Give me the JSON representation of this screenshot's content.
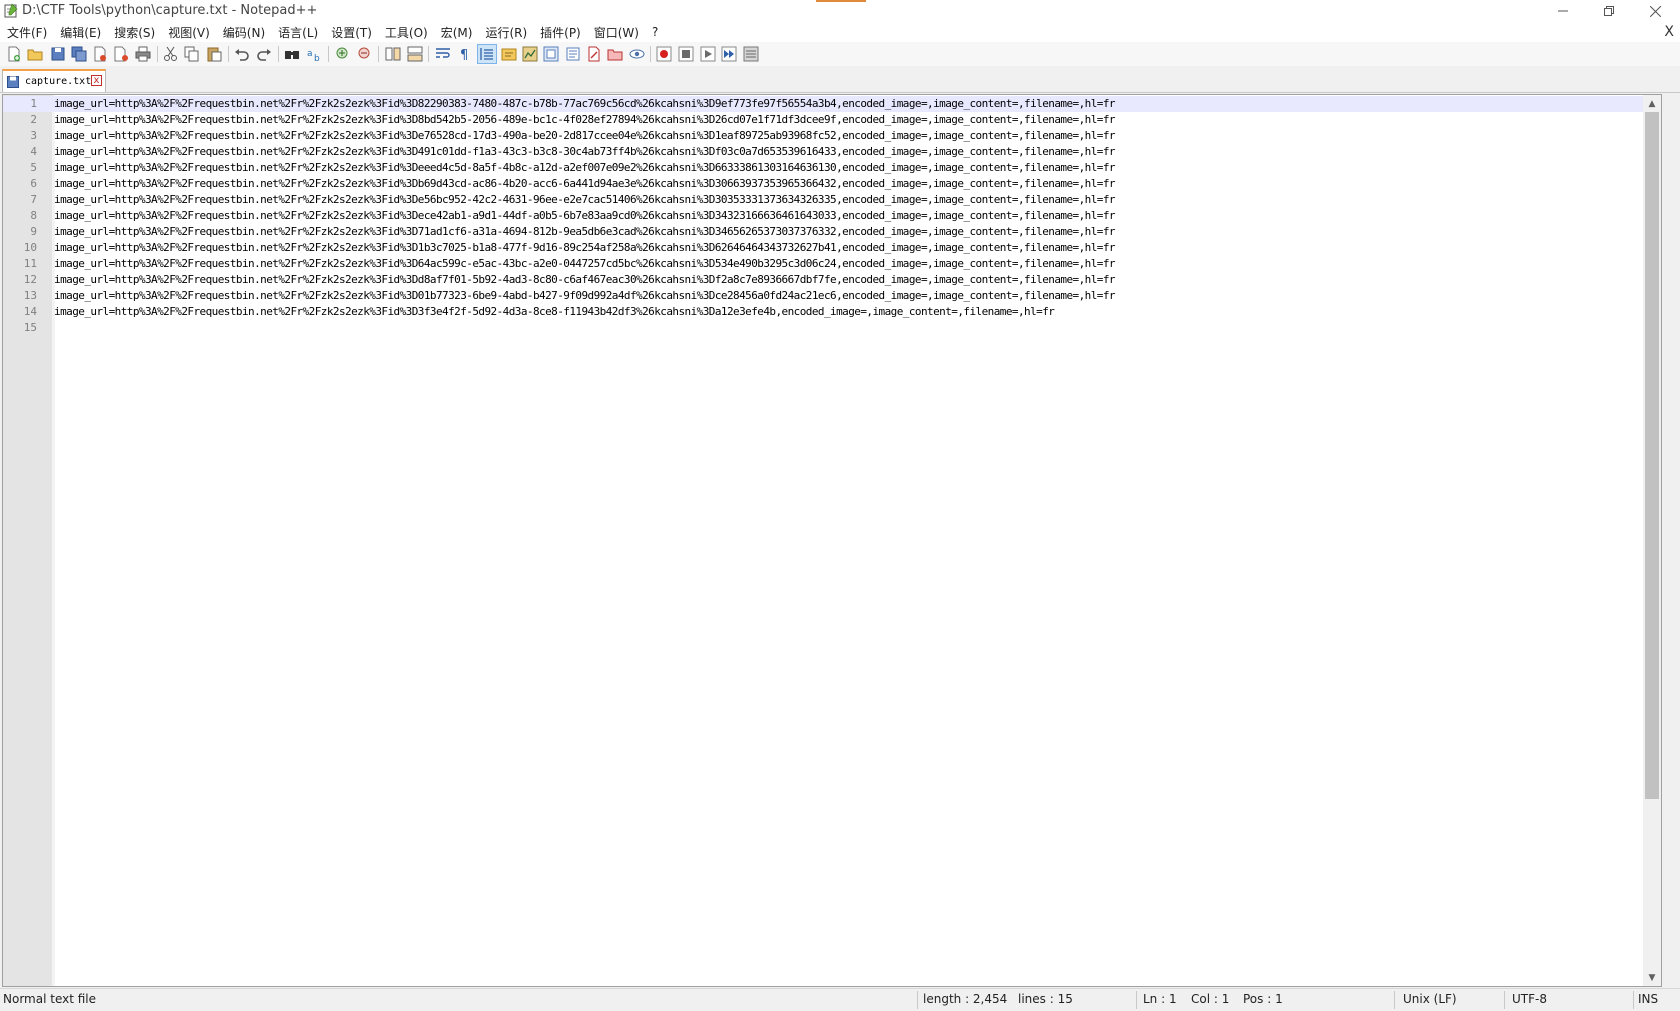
{
  "window": {
    "title": "D:\\CTF Tools\\python\\capture.txt - Notepad++",
    "minimize_icon": "minimize-icon",
    "restore_icon": "restore-icon",
    "close_icon": "close-icon"
  },
  "menu": {
    "items": [
      "文件(F)",
      "编辑(E)",
      "搜索(S)",
      "视图(V)",
      "编码(N)",
      "语言(L)",
      "设置(T)",
      "工具(O)",
      "宏(M)",
      "运行(R)",
      "插件(P)",
      "窗口(W)",
      "?"
    ],
    "close_label": "X"
  },
  "toolbar": {
    "active_button": "word-wrap"
  },
  "tab": {
    "label": "capture.txt",
    "close_label": "x"
  },
  "editor": {
    "current_line": 1,
    "lines": [
      {
        "n": "1",
        "text": "image_url=http%3A%2F%2Frequestbin.net%2Fr%2Fzk2s2ezk%3Fid%3D82290383-7480-487c-b78b-77ac769c56cd%26kcahsni%3D9ef773fe97f56554a3b4,encoded_image=,image_content=,filename=,hl=fr"
      },
      {
        "n": "2",
        "text": "image_url=http%3A%2F%2Frequestbin.net%2Fr%2Fzk2s2ezk%3Fid%3D8bd542b5-2056-489e-bc1c-4f028ef27894%26kcahsni%3D26cd07e1f71df3dcee9f,encoded_image=,image_content=,filename=,hl=fr"
      },
      {
        "n": "3",
        "text": "image_url=http%3A%2F%2Frequestbin.net%2Fr%2Fzk2s2ezk%3Fid%3De76528cd-17d3-490a-be20-2d817ccee04e%26kcahsni%3D1eaf89725ab93968fc52,encoded_image=,image_content=,filename=,hl=fr"
      },
      {
        "n": "4",
        "text": "image_url=http%3A%2F%2Frequestbin.net%2Fr%2Fzk2s2ezk%3Fid%3D491c01dd-f1a3-43c3-b3c8-30c4ab73ff4b%26kcahsni%3Df03c0a7d653539616433,encoded_image=,image_content=,filename=,hl=fr"
      },
      {
        "n": "5",
        "text": "image_url=http%3A%2F%2Frequestbin.net%2Fr%2Fzk2s2ezk%3Fid%3Deeed4c5d-8a5f-4b8c-a12d-a2ef007e09e2%26kcahsni%3D66333861303164636130,encoded_image=,image_content=,filename=,hl=fr"
      },
      {
        "n": "6",
        "text": "image_url=http%3A%2F%2Frequestbin.net%2Fr%2Fzk2s2ezk%3Fid%3Db69d43cd-ac86-4b20-acc6-6a441d94ae3e%26kcahsni%3D30663937353965366432,encoded_image=,image_content=,filename=,hl=fr"
      },
      {
        "n": "7",
        "text": "image_url=http%3A%2F%2Frequestbin.net%2Fr%2Fzk2s2ezk%3Fid%3De56bc952-42c2-4631-96ee-e2e7cac51406%26kcahsni%3D30353331373634326335,encoded_image=,image_content=,filename=,hl=fr"
      },
      {
        "n": "8",
        "text": "image_url=http%3A%2F%2Frequestbin.net%2Fr%2Fzk2s2ezk%3Fid%3Dece42ab1-a9d1-44df-a0b5-6b7e83aa9cd0%26kcahsni%3D34323166636461643033,encoded_image=,image_content=,filename=,hl=fr"
      },
      {
        "n": "9",
        "text": "image_url=http%3A%2F%2Frequestbin.net%2Fr%2Fzk2s2ezk%3Fid%3D71ad1cf6-a31a-4694-812b-9ea5db6e3cad%26kcahsni%3D34656265373037376332,encoded_image=,image_content=,filename=,hl=fr"
      },
      {
        "n": "10",
        "text": "image_url=http%3A%2F%2Frequestbin.net%2Fr%2Fzk2s2ezk%3Fid%3D1b3c7025-b1a8-477f-9d16-89c254af258a%26kcahsni%3D62646464343732627b41,encoded_image=,image_content=,filename=,hl=fr"
      },
      {
        "n": "11",
        "text": "image_url=http%3A%2F%2Frequestbin.net%2Fr%2Fzk2s2ezk%3Fid%3D64ac599c-e5ac-43bc-a2e0-0447257cd5bc%26kcahsni%3D534e490b3295c3d06c24,encoded_image=,image_content=,filename=,hl=fr"
      },
      {
        "n": "12",
        "text": "image_url=http%3A%2F%2Frequestbin.net%2Fr%2Fzk2s2ezk%3Fid%3Dd8af7f01-5b92-4ad3-8c80-c6af467eac30%26kcahsni%3Df2a8c7e8936667dbf7fe,encoded_image=,image_content=,filename=,hl=fr"
      },
      {
        "n": "13",
        "text": "image_url=http%3A%2F%2Frequestbin.net%2Fr%2Fzk2s2ezk%3Fid%3D01b77323-6be9-4abd-b427-9f09d992a4df%26kcahsni%3Dce28456a0fd24ac21ec6,encoded_image=,image_content=,filename=,hl=fr"
      },
      {
        "n": "14",
        "text": "image_url=http%3A%2F%2Frequestbin.net%2Fr%2Fzk2s2ezk%3Fid%3D3f3e4f2f-5d92-4d3a-8ce8-f11943b42df3%26kcahsni%3Da12e3efe4b,encoded_image=,image_content=,filename=,hl=fr"
      },
      {
        "n": "15",
        "text": ""
      }
    ]
  },
  "status": {
    "file_type": "Normal text file",
    "length": "length : 2,454",
    "lines": "lines : 15",
    "ln": "Ln : 1",
    "col": "Col : 1",
    "pos": "Pos : 1",
    "eol": "Unix (LF)",
    "encoding": "UTF-8",
    "mode": "INS"
  }
}
